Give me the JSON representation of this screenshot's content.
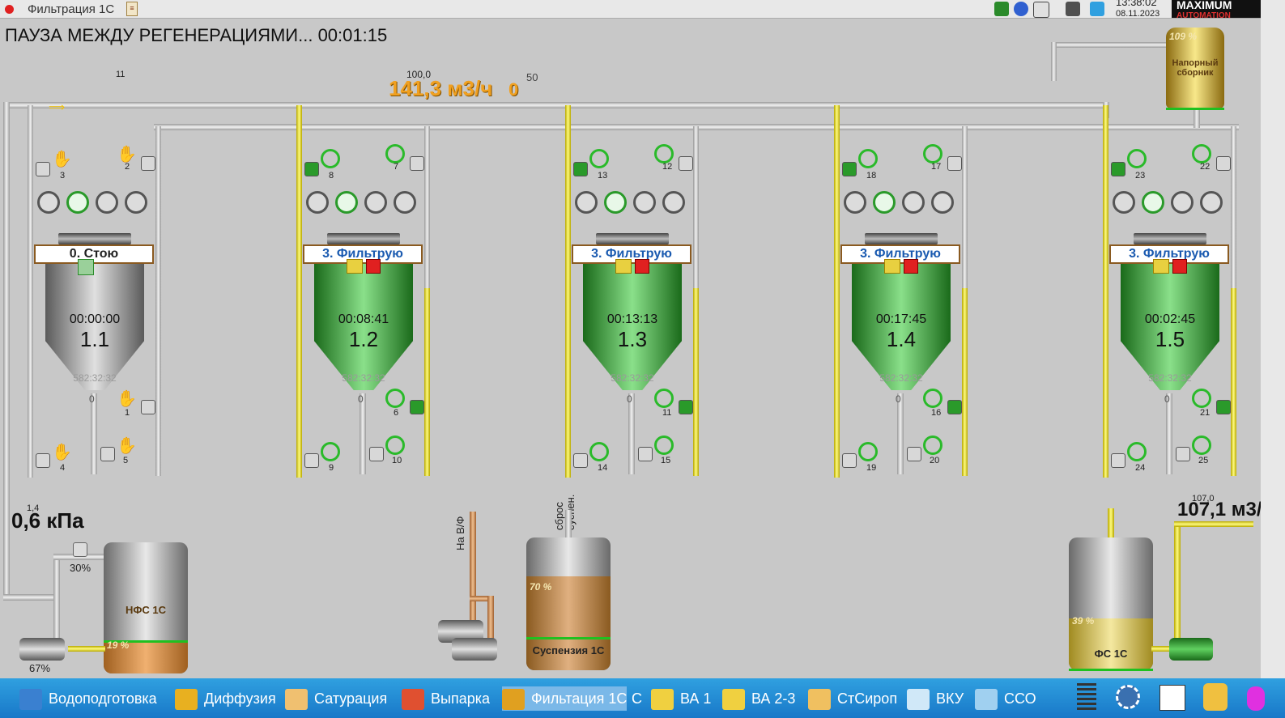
{
  "window": {
    "title": "Фильтрация 1С"
  },
  "tray": {
    "time": "13:38:02",
    "date": "08.11.2023",
    "logo_text": "MAXIMUM",
    "logo_sub": "AUTOMATION"
  },
  "status": {
    "text": "ПАУЗА МЕЖДУ РЕГЕНЕРАЦИЯМИ... 00:01:15"
  },
  "top": {
    "label_11": "11",
    "setpoint": "100,0",
    "flow": "141,3 м3/ч",
    "flow_extra": "0",
    "flow_limit": "50"
  },
  "pressure": {
    "small": "1,4",
    "value": "0,6 кПа",
    "valve_pct": "30%",
    "pump_pct": "67%"
  },
  "outflow": {
    "small": "107,0",
    "value": "107,1 м3/"
  },
  "head_tank": {
    "label": "Напорный сборник",
    "pct": "109 %"
  },
  "filters": [
    {
      "num": "1.1",
      "mode": "0. Стою",
      "time": "00:00:00",
      "hours": "582:32:32",
      "level": "0",
      "v": [
        "3",
        "2",
        "1",
        "4",
        "5"
      ],
      "state": "stop"
    },
    {
      "num": "1.2",
      "mode": "3. Фильтрую",
      "time": "00:08:41",
      "hours": "582:32:32",
      "level": "0",
      "v": [
        "8",
        "7",
        "6",
        "9",
        "10"
      ],
      "state": "run"
    },
    {
      "num": "1.3",
      "mode": "3. Фильтрую",
      "time": "00:13:13",
      "hours": "582:32:32",
      "level": "0",
      "v": [
        "13",
        "12",
        "11",
        "14",
        "15"
      ],
      "state": "run"
    },
    {
      "num": "1.4",
      "mode": "3. Фильтрую",
      "time": "00:17:45",
      "hours": "582:32:32",
      "level": "0",
      "v": [
        "18",
        "17",
        "16",
        "19",
        "20"
      ],
      "state": "run"
    },
    {
      "num": "1.5",
      "mode": "3. Фильтрую",
      "time": "00:02:45",
      "hours": "582:32:32",
      "level": "0",
      "v": [
        "23",
        "22",
        "21",
        "24",
        "25"
      ],
      "state": "run"
    }
  ],
  "tanks": {
    "nfs": {
      "label": "НФС 1С",
      "pct": "19 %"
    },
    "susp": {
      "label": "Суспензия 1С",
      "pct": "70 %",
      "sbros": "сброс суспен.",
      "nav": "На В/Ф"
    },
    "fs": {
      "label": "ФС 1С",
      "pct": "39 %"
    }
  },
  "taskbar": [
    {
      "label": "Водоподготовка",
      "color": "#3a80d0"
    },
    {
      "label": "Диффузия",
      "color": "#e8b020"
    },
    {
      "label": "Сатурация",
      "color": "#f0c070"
    },
    {
      "label": "Выпарка",
      "color": "#e05030"
    },
    {
      "label": "Фильтация 1С",
      "color": "#e0a020",
      "active": true
    },
    {
      "label": "С",
      "color": ""
    },
    {
      "label": "ВА 1",
      "color": "#f0d040"
    },
    {
      "label": "ВА 2-3",
      "color": "#f0d040"
    },
    {
      "label": "СтСироп",
      "color": "#f0c060"
    },
    {
      "label": "ВКУ",
      "color": "#d0e8f8"
    },
    {
      "label": "ССО",
      "color": "#a0d0f0"
    }
  ],
  "colors": {
    "active_green": "#3aa03a",
    "stop_gray": "#8a8a8a",
    "flow_orange": "#f0a020",
    "taskbar": "#1878c8"
  }
}
